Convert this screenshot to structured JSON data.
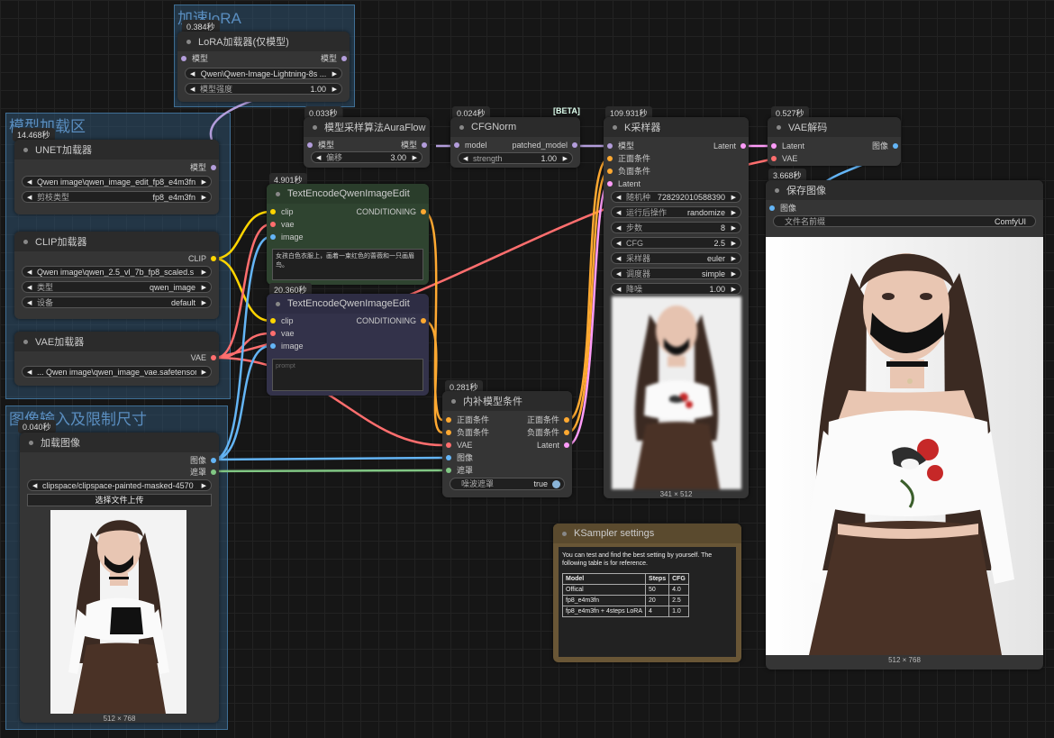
{
  "colors": {
    "model": "#b39ddb",
    "clip": "#ffd500",
    "vae": "#ff6e6e",
    "conditioning": "#ffa931",
    "latent": "#ff9cf9",
    "image": "#64b5f6",
    "mask": "#81c784"
  },
  "groups": {
    "lora": "加速loRA",
    "model_load": "模型加载区",
    "image_input": "图像输入及限制尺寸"
  },
  "lora_node": {
    "timing": "0.384秒",
    "title": "LoRA加载器(仅模型)",
    "in_model": "模型",
    "out_model": "模型",
    "lora_name": "Qwen\\Qwen-Image-Lightning-8s ...",
    "strength_label": "模型强度",
    "strength_value": "1.00"
  },
  "unet_node": {
    "timing": "14.468秒",
    "title": "UNET加载器",
    "out_model": "模型",
    "unet_name": "Qwen image\\qwen_image_edit_fp8_e4m3fn....",
    "dtype_label": "剪枝类型",
    "dtype_value": "fp8_e4m3fn"
  },
  "clip_node": {
    "title": "CLIP加载器",
    "out_clip": "CLIP",
    "clip_name": "Qwen image\\qwen_2.5_vl_7b_fp8_scaled.s ...",
    "type_label": "类型",
    "type_value": "qwen_image",
    "device_label": "设备",
    "device_value": "default"
  },
  "vae_node": {
    "title": "VAE加载器",
    "out_vae": "VAE",
    "vae_name": "... Qwen image\\qwen_image_vae.safetensors"
  },
  "load_image_node": {
    "timing": "0.040秒",
    "title": "加载图像",
    "out_image": "图像",
    "out_mask": "遮罩",
    "image_name": "clipspace/clipspace-painted-masked-4570 ...",
    "upload": "选择文件上传",
    "size": "512 × 768"
  },
  "aura_node": {
    "timing": "0.033秒",
    "title": "模型采样算法AuraFlow",
    "in_model": "模型",
    "out_model": "模型",
    "shift_label": "偏移",
    "shift_value": "3.00"
  },
  "cfgnorm_node": {
    "timing": "0.024秒",
    "beta": "[BETA]",
    "title": "CFGNorm",
    "in_model": "model",
    "out_model": "patched_model",
    "strength_label": "strength",
    "strength_value": "1.00"
  },
  "te1_node": {
    "timing": "4.901秒",
    "title": "TextEncodeQwenImageEdit",
    "in_clip": "clip",
    "in_vae": "vae",
    "in_image": "image",
    "out": "CONDITIONING",
    "prompt": "女孩白色衣服上，画着一束红色的蔷薇和一只画眉鸟。"
  },
  "te2_node": {
    "timing": "20.360秒",
    "title": "TextEncodeQwenImageEdit",
    "in_clip": "clip",
    "in_vae": "vae",
    "in_image": "image",
    "out": "CONDITIONING",
    "prompt": "prompt"
  },
  "inpaint_node": {
    "timing": "0.281秒",
    "title": "内补模型条件",
    "in_pos": "正面条件",
    "in_neg": "负面条件",
    "in_vae": "VAE",
    "in_image": "图像",
    "in_mask": "遮罩",
    "out_pos": "正面条件",
    "out_neg": "负面条件",
    "out_latent": "Latent",
    "noise_label": "噪波遮罩",
    "noise_value": "true"
  },
  "ksampler_node": {
    "timing": "109.931秒",
    "title": "K采样器",
    "in_model": "模型",
    "in_pos": "正面条件",
    "in_neg": "负面条件",
    "in_latent": "Latent",
    "out_latent": "Latent",
    "widgets": [
      {
        "label": "随机种",
        "value": "728292010588390"
      },
      {
        "label": "运行后操作",
        "value": "randomize"
      },
      {
        "label": "步数",
        "value": "8"
      },
      {
        "label": "CFG",
        "value": "2.5"
      },
      {
        "label": "采样器",
        "value": "euler"
      },
      {
        "label": "调度器",
        "value": "simple"
      },
      {
        "label": "降噪",
        "value": "1.00"
      }
    ],
    "preview_size": "341 × 512"
  },
  "vaedecode_node": {
    "timing": "0.527秒",
    "title": "VAE解码",
    "in_latent": "Latent",
    "in_vae": "VAE",
    "out_image": "图像"
  },
  "save_node": {
    "timing": "3.668秒",
    "title": "保存图像",
    "in_image": "图像",
    "prefix_label": "文件名前缀",
    "prefix_value": "ComfyUI",
    "size": "512 × 768"
  },
  "note_node": {
    "title": "KSampler settings",
    "text": "You can test and find the best setting by yourself. The following table is for reference.",
    "header": [
      "Model",
      "Steps",
      "CFG"
    ],
    "rows": [
      [
        "Offical",
        "50",
        "4.0"
      ],
      [
        "fp8_e4m3fn",
        "20",
        "2.5"
      ],
      [
        "fp8_e4m3fn + 4steps LoRA",
        "4",
        "1.0"
      ]
    ]
  }
}
